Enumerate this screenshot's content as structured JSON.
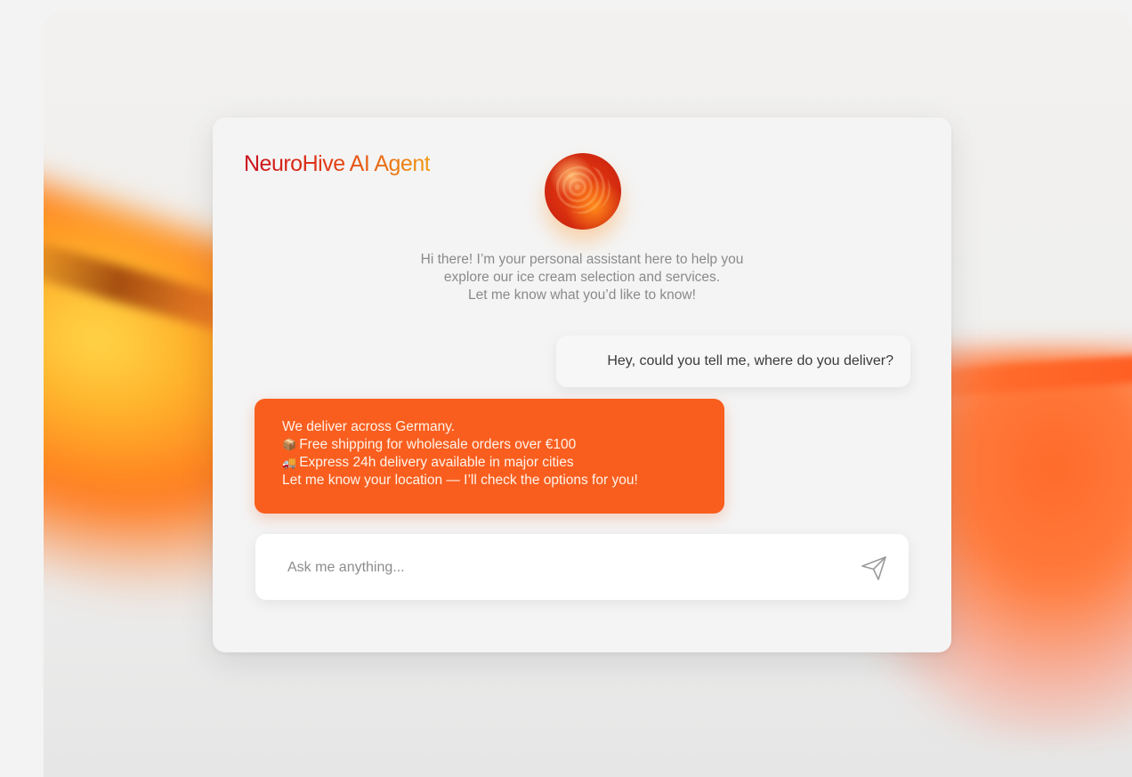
{
  "brand": {
    "title": "NeuroHive AI Agent"
  },
  "greeting": {
    "lines": [
      "Hi there! I’m your personal assistant here to help you",
      "explore our ice cream selection and services.",
      "Let me know what you’d like to know!"
    ]
  },
  "conversation": {
    "user_message": "Hey, could you tell me, where do you deliver?",
    "bot_message": {
      "lines": [
        {
          "icon": "",
          "text": "We deliver across Germany."
        },
        {
          "icon": "📦",
          "text": "Free shipping for wholesale orders over €100"
        },
        {
          "icon": "🚚",
          "text": "Express 24h delivery available in major cities"
        },
        {
          "icon": "",
          "text": "Let me know your location — I’ll check the options for you!"
        }
      ]
    }
  },
  "composer": {
    "placeholder": "Ask me anything...",
    "value": "",
    "send_icon": "send-icon"
  },
  "colors": {
    "accent": "#f95e1e",
    "brand_start": "#c8101f",
    "brand_end": "#f19a14"
  }
}
